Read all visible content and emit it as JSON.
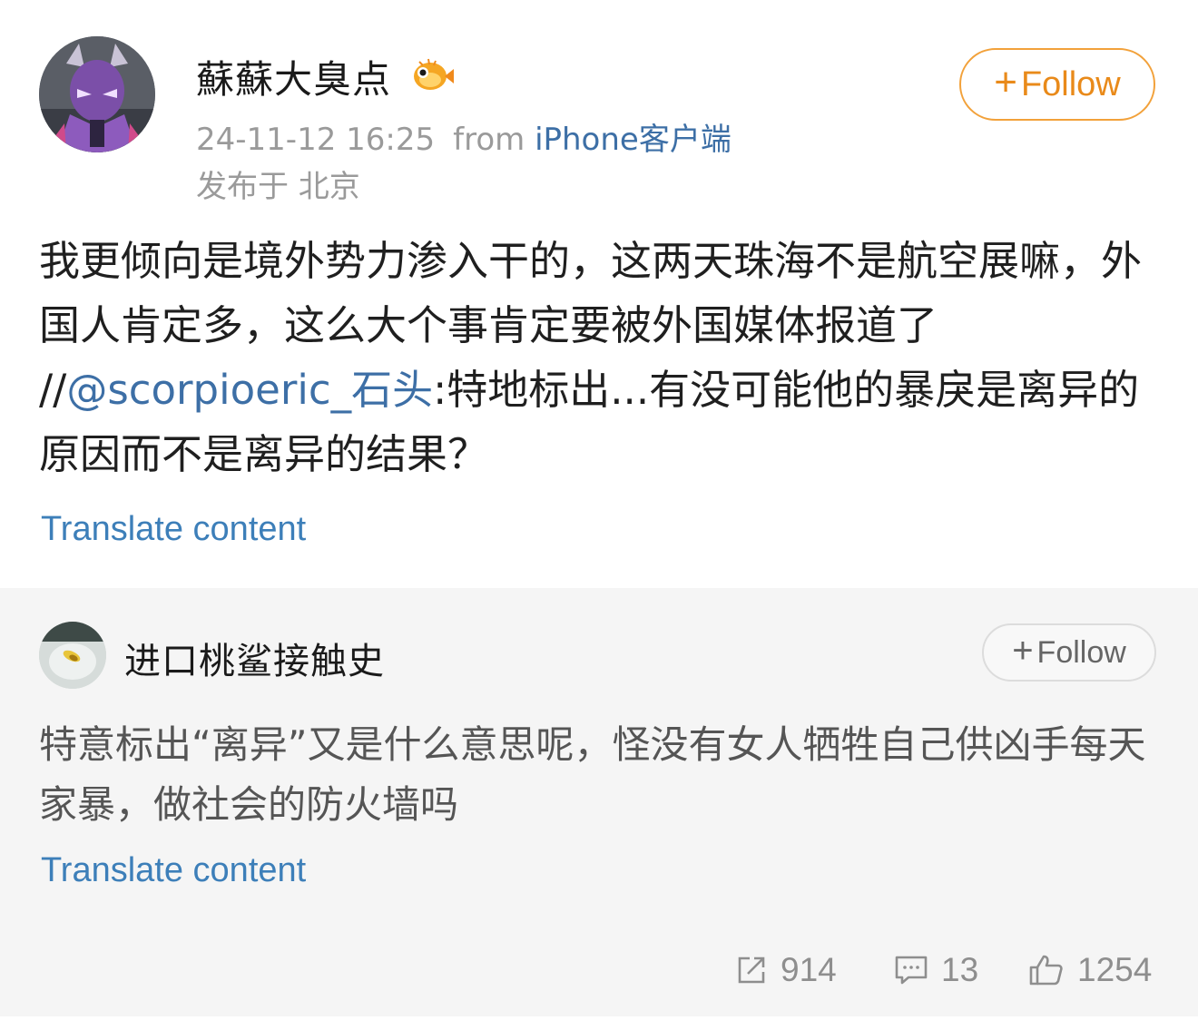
{
  "post": {
    "username": "蘇蘇大臭点",
    "badge_icon": "pufferfish-badge-icon",
    "timestamp": "24-11-12 16:25",
    "from_label": "from",
    "source": "iPhone客户端",
    "location": "发布于 北京",
    "follow_label": "Follow",
    "body_text": "我更倾向是境外势力渗入干的，这两天珠海不是航空展嘛，外国人肯定多，这么大个事肯定要被外国媒体报道了 //",
    "mention": "@scorpioeric_石头",
    "body_text_after": ":特地标出...有没可能他的暴戾是离异的原因而不是离异的结果？",
    "translate_label": "Translate content"
  },
  "repost": {
    "username": "进口桃鲨接触史",
    "follow_label": "Follow",
    "body_text": "特意标出“离异”又是什么意思呢，怪没有女人牺牲自己供凶手每天家暴，做社会的防火墙吗",
    "translate_label": "Translate content"
  },
  "actions": {
    "share_count": "914",
    "comment_count": "13",
    "like_count": "1254"
  },
  "colors": {
    "follow_accent": "#e98a1a",
    "link_blue": "#3d6fa6",
    "repost_background": "#f5f5f5"
  }
}
